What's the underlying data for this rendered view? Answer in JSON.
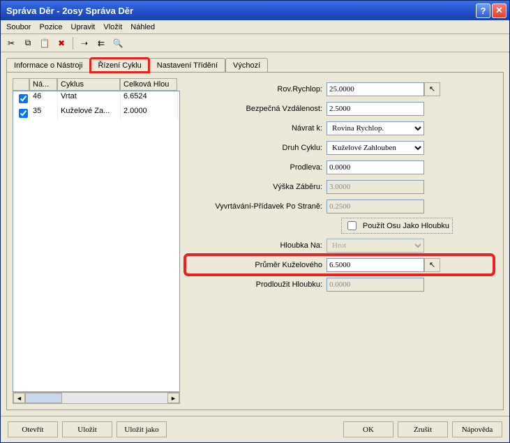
{
  "window": {
    "title": "Správa Děr - 2osy Správa Děr"
  },
  "menus": {
    "file": "Soubor",
    "pos": "Pozice",
    "edit": "Upravit",
    "insert": "Vložit",
    "view": "Náhled"
  },
  "toolbar_icons": {
    "cut": "✂",
    "copy": "⧉",
    "paste": "📋",
    "delete": "✖",
    "a": "➝",
    "b": "⇇",
    "c": "🔍"
  },
  "tabs": {
    "info": "Informace o Nástroji",
    "cycle": "Řízení Cyklu",
    "sort": "Nastavení Třídění",
    "default": "Výchozí"
  },
  "grid": {
    "headers": {
      "chk": "",
      "na": "Ná...",
      "cycle": "Cyklus",
      "depth": "Celková Hlou"
    },
    "rows": [
      {
        "checked": true,
        "na": "46",
        "cycle": "Vrtat",
        "depth": "6.6524"
      },
      {
        "checked": true,
        "na": "35",
        "cycle": "Kuželové Za...",
        "depth": "2.0000"
      }
    ]
  },
  "form": {
    "rov_label": "Rov.Rychlop:",
    "rov_value": "25.0000",
    "bezp_label": "Bezpečná Vzdálenost:",
    "bezp_value": "2.5000",
    "navrat_label": "Návrat k:",
    "navrat_value": "Rovina Rychlop.",
    "druh_label": "Druh Cyklu:",
    "druh_value": "Kuželové Zahlouben",
    "prodleva_label": "Prodleva:",
    "prodleva_value": "0.0000",
    "vyska_label": "Výška Záběru:",
    "vyska_value": "3.0000",
    "vyvrt_label": "Vyvrtávání-Přídavek Po Straně:",
    "vyvrt_value": "0.2500",
    "osu_label": "Použít Osu Jako Hloubku",
    "hloubka_label": "Hloubka Na:",
    "hloubka_value": "Hrot",
    "prumer_label": "Průměr Kuželového",
    "prumer_value": "6.5000",
    "prodl_label": "Prodloužit Hloubku:",
    "prodl_value": "0.0000"
  },
  "buttons": {
    "open": "Otevřít",
    "save": "Uložit",
    "saveas": "Uložit jako",
    "ok": "OK",
    "cancel": "Zrušit",
    "help": "Nápověda"
  },
  "glyph": {
    "help": "?",
    "close": "✕",
    "cursor": "↖",
    "dropdown": "▾",
    "left": "◄",
    "right": "►"
  }
}
